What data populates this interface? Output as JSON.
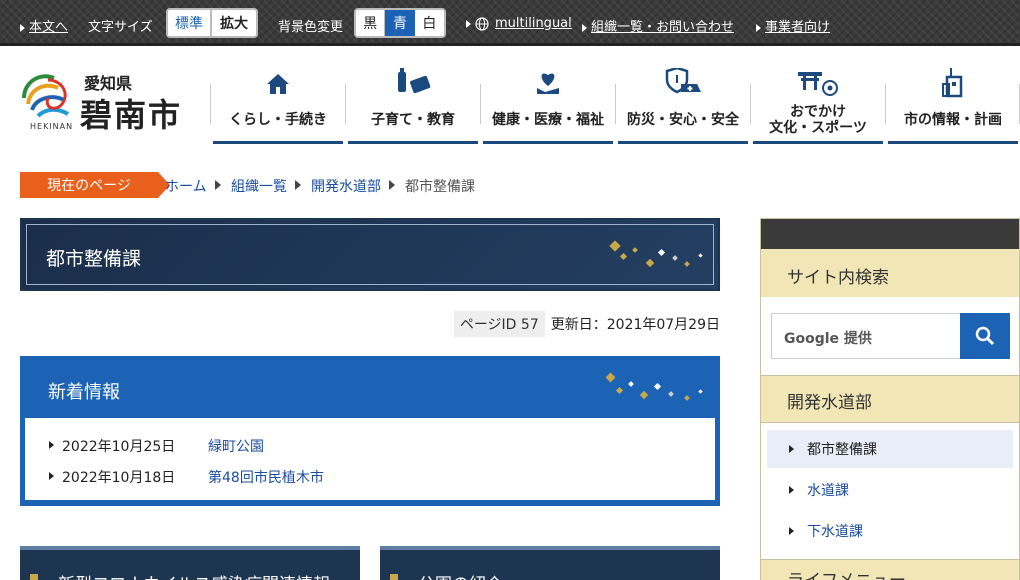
{
  "topbar": {
    "skip_link": "本文へ",
    "font_size_label": "文字サイズ",
    "font_standard": "標準",
    "font_large": "拡大",
    "bg_color_label": "背景色変更",
    "bg_black": "黒",
    "bg_blue": "青",
    "bg_white": "白",
    "multilingual": "multilingual",
    "org_contact": "組織一覧・お問い合わせ",
    "business": "事業者向け"
  },
  "logo": {
    "prefecture": "愛知県",
    "city": "碧南市",
    "romaji": "HEKINAN"
  },
  "nav": [
    {
      "label": "くらし・手続き",
      "icon": "house-icon"
    },
    {
      "label": "子育て・教育",
      "icon": "bottle-book-icon"
    },
    {
      "label": "健康・医療・福祉",
      "icon": "heart-hand-icon"
    },
    {
      "label": "防災・安心・安全",
      "icon": "shield-ambulance-icon"
    },
    {
      "label_line1": "おでかけ",
      "label_line2": "文化・スポーツ",
      "icon": "gate-ball-icon"
    },
    {
      "label": "市の情報・計画",
      "icon": "city-hall-icon"
    }
  ],
  "breadcrumb": {
    "current_label": "現在のページ",
    "items": [
      "ホーム",
      "組織一覧",
      "開発水道部"
    ],
    "current": "都市整備課"
  },
  "page": {
    "title": "都市整備課",
    "page_id_label": "ページID 57",
    "updated": "更新日：2021年07月29日"
  },
  "news": {
    "heading": "新着情報",
    "items": [
      {
        "date": "2022年10月25日",
        "title": "緑町公園"
      },
      {
        "date": "2022年10月18日",
        "title": "第48回市民植木市"
      }
    ]
  },
  "cards": [
    {
      "title": "新型コロナウイルス感染症関連情報"
    },
    {
      "title": "公園の紹介"
    }
  ],
  "sidebar": {
    "search_heading": "サイト内検索",
    "search_placeholder": "Google 提供",
    "dept_heading": "開発水道部",
    "dept_items": [
      "都市整備課",
      "水道課",
      "下水道課"
    ],
    "life_heading": "ライフメニュー"
  },
  "colors": {
    "nav_underline": "#1c4a7e",
    "breadcrumb_current": "#e8601c",
    "news_blue": "#1d63b5",
    "title_navy": "#1e3552",
    "side_beige": "#f1e6b6"
  }
}
